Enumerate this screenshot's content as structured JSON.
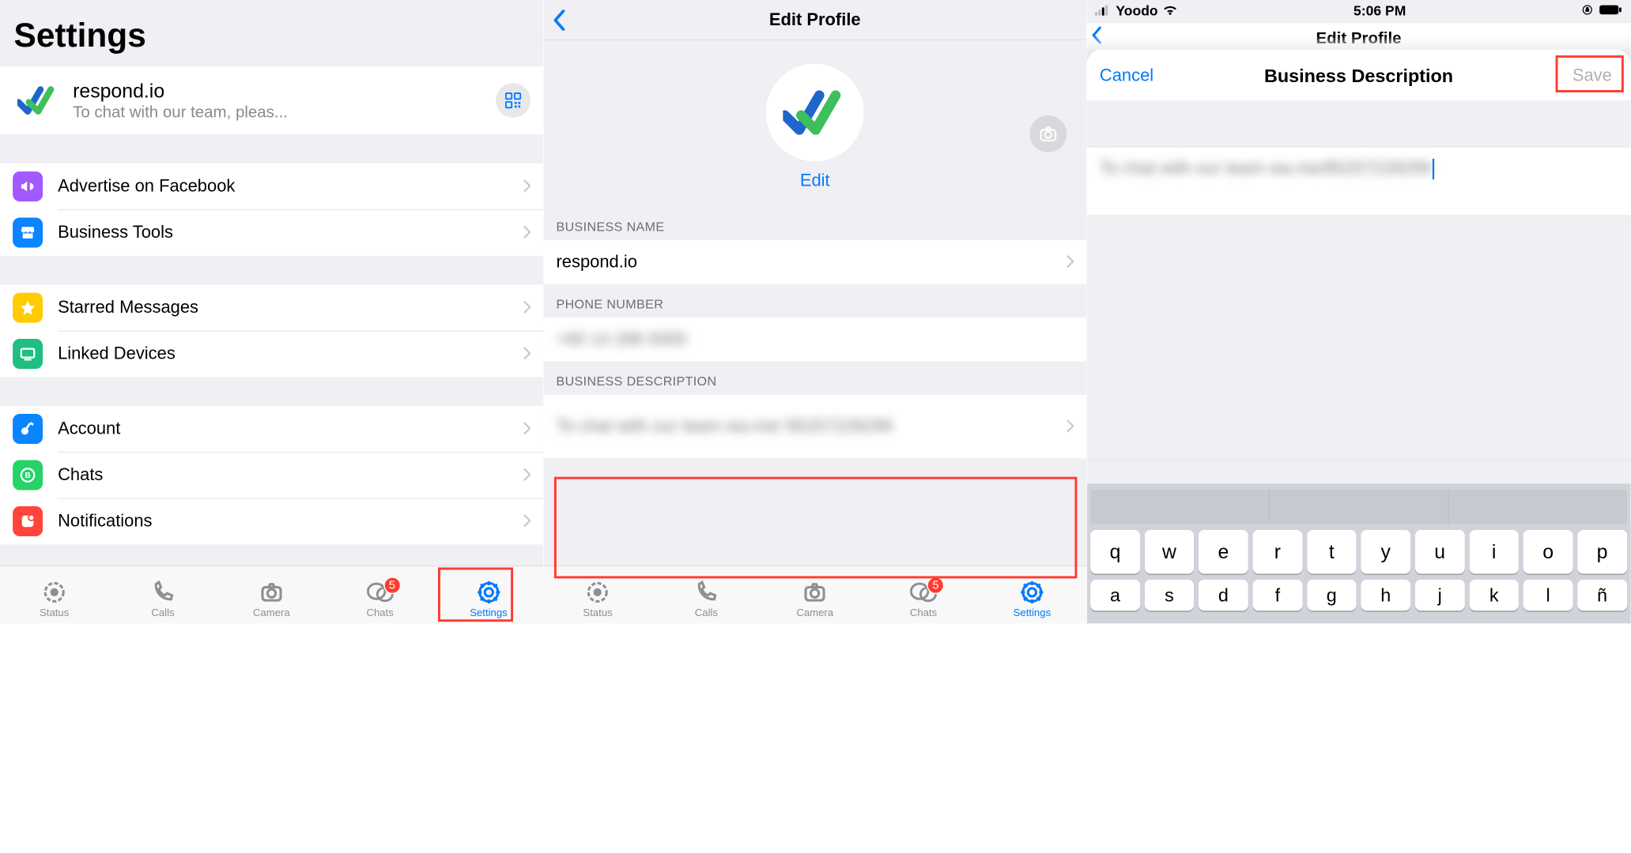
{
  "pane1": {
    "title": "Settings",
    "profile": {
      "name": "respond.io",
      "subtitle": "To chat with our team, pleas..."
    },
    "group_business": [
      {
        "label": "Advertise on Facebook",
        "icon": "megaphone-icon",
        "color": "#a259ff"
      },
      {
        "label": "Business Tools",
        "icon": "storefront-icon",
        "color": "#0a84ff"
      }
    ],
    "group_util": [
      {
        "label": "Starred Messages",
        "icon": "star-icon",
        "color": "#ffcc00"
      },
      {
        "label": "Linked Devices",
        "icon": "display-icon",
        "color": "#1fbf82"
      }
    ],
    "group_settings": [
      {
        "label": "Account",
        "icon": "key-icon",
        "color": "#0a84ff"
      },
      {
        "label": "Chats",
        "icon": "badge-icon",
        "color": "#25d366"
      },
      {
        "label": "Notifications",
        "icon": "notif-icon",
        "color": "#ff453a"
      }
    ],
    "tabs": [
      {
        "label": "Status",
        "icon": "status-ring-icon",
        "active": false
      },
      {
        "label": "Calls",
        "icon": "phone-icon",
        "active": false
      },
      {
        "label": "Camera",
        "icon": "camera-icon",
        "active": false
      },
      {
        "label": "Chats",
        "icon": "chats-icon",
        "active": false,
        "badge": "5"
      },
      {
        "label": "Settings",
        "icon": "gear-icon",
        "active": true
      }
    ]
  },
  "pane2": {
    "nav_title": "Edit Profile",
    "edit_label": "Edit",
    "headers": {
      "biz_name": "BUSINESS NAME",
      "phone": "PHONE NUMBER",
      "biz_desc": "BUSINESS DESCRIPTION"
    },
    "values": {
      "biz_name": "respond.io",
      "phone_blurred": "+60 14 288 0000",
      "biz_desc_blurred": "To chat with our team wa.me/ 85257228299"
    },
    "tabs": [
      {
        "label": "Status",
        "icon": "status-ring-icon",
        "active": false
      },
      {
        "label": "Calls",
        "icon": "phone-icon",
        "active": false
      },
      {
        "label": "Camera",
        "icon": "camera-icon",
        "active": false
      },
      {
        "label": "Chats",
        "icon": "chats-icon",
        "active": false,
        "badge": "5"
      },
      {
        "label": "Settings",
        "icon": "gear-icon",
        "active": true
      }
    ]
  },
  "pane3": {
    "statusbar": {
      "carrier": "Yoodo",
      "time": "5:06 PM"
    },
    "peek_title": "Edit Profile",
    "sheet": {
      "cancel": "Cancel",
      "title": "Business Description",
      "save": "Save"
    },
    "textarea_value_blurred": "To chat with our team wa.me/85257228299",
    "keyboard_row1": [
      "q",
      "w",
      "e",
      "r",
      "t",
      "y",
      "u",
      "i",
      "o",
      "p"
    ],
    "keyboard_row2": [
      "a",
      "s",
      "d",
      "f",
      "g",
      "h",
      "j",
      "k",
      "l"
    ],
    "keyboard_row2_extra": "ñ"
  }
}
